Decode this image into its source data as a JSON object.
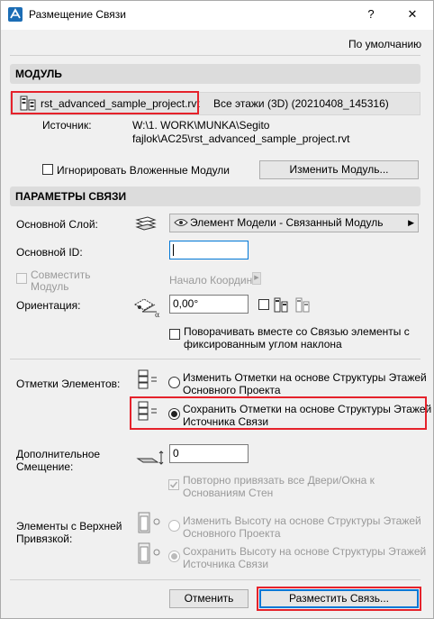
{
  "window": {
    "title": "Размещение Связи",
    "help": "?",
    "close": "✕"
  },
  "defaults_link": "По умолчанию",
  "module": {
    "header": "МОДУЛЬ",
    "file": "rst_advanced_sample_project.rvt",
    "stories": "Все этажи (3D) (20210408_145316)",
    "source_label": "Источник:",
    "source_line1": "W:\\1. WORK\\MUNKA\\Segito",
    "source_line2": "fajlok\\AC25\\rst_advanced_sample_project.rvt",
    "ignore_nested_label": "Игнорировать Вложенные Модули",
    "change_module_button": "Изменить Модуль..."
  },
  "params": {
    "header": "ПАРАМЕТРЫ СВЯЗИ",
    "main_layer_label": "Основной Слой:",
    "main_layer_value": "Элемент Модели - Связанный Модуль",
    "main_id_label": "Основной ID:",
    "main_id_value": "",
    "align_module_label_1": "Совместить",
    "align_module_label_2": "Модуль",
    "origin_label": "Начало Координ",
    "orientation_label": "Ориентация:",
    "orientation_value": "0,00°",
    "rotate_fixed_line1": "Поворачивать вместе со Связью элементы с",
    "rotate_fixed_line2": "фиксированным углом наклона"
  },
  "elevations": {
    "label": "Отметки Элементов:",
    "option1_line1": "Изменить Отметки на основе Структуры Этажей",
    "option1_line2": "Основного Проекта",
    "option2_line1": "Сохранить Отметки на основе Структуры Этажей",
    "option2_line2": "Источника Связи",
    "selected": 2
  },
  "offset": {
    "label_line1": "Дополнительное",
    "label_line2": "Смещение:",
    "value": "0",
    "reconnect_line1": "Повторно привязать все Двери/Окна к",
    "reconnect_line2": "Основаниям Стен"
  },
  "top_linked": {
    "label_line1": "Элементы с Верхней",
    "label_line2": "Привязкой:",
    "option1_line1": "Изменить Высоту на основе Структуры Этажей",
    "option1_line2": "Основного Проекта",
    "option2_line1": "Сохранить Высоту на основе Структуры Этажей",
    "option2_line2": "Источника Связи",
    "selected": 2
  },
  "footer": {
    "cancel_button": "Отменить",
    "place_button": "Разместить Связь..."
  },
  "colors": {
    "highlight": "#e5222b",
    "section_bg": "#dcdcdc",
    "primary_border": "#0078d7"
  }
}
